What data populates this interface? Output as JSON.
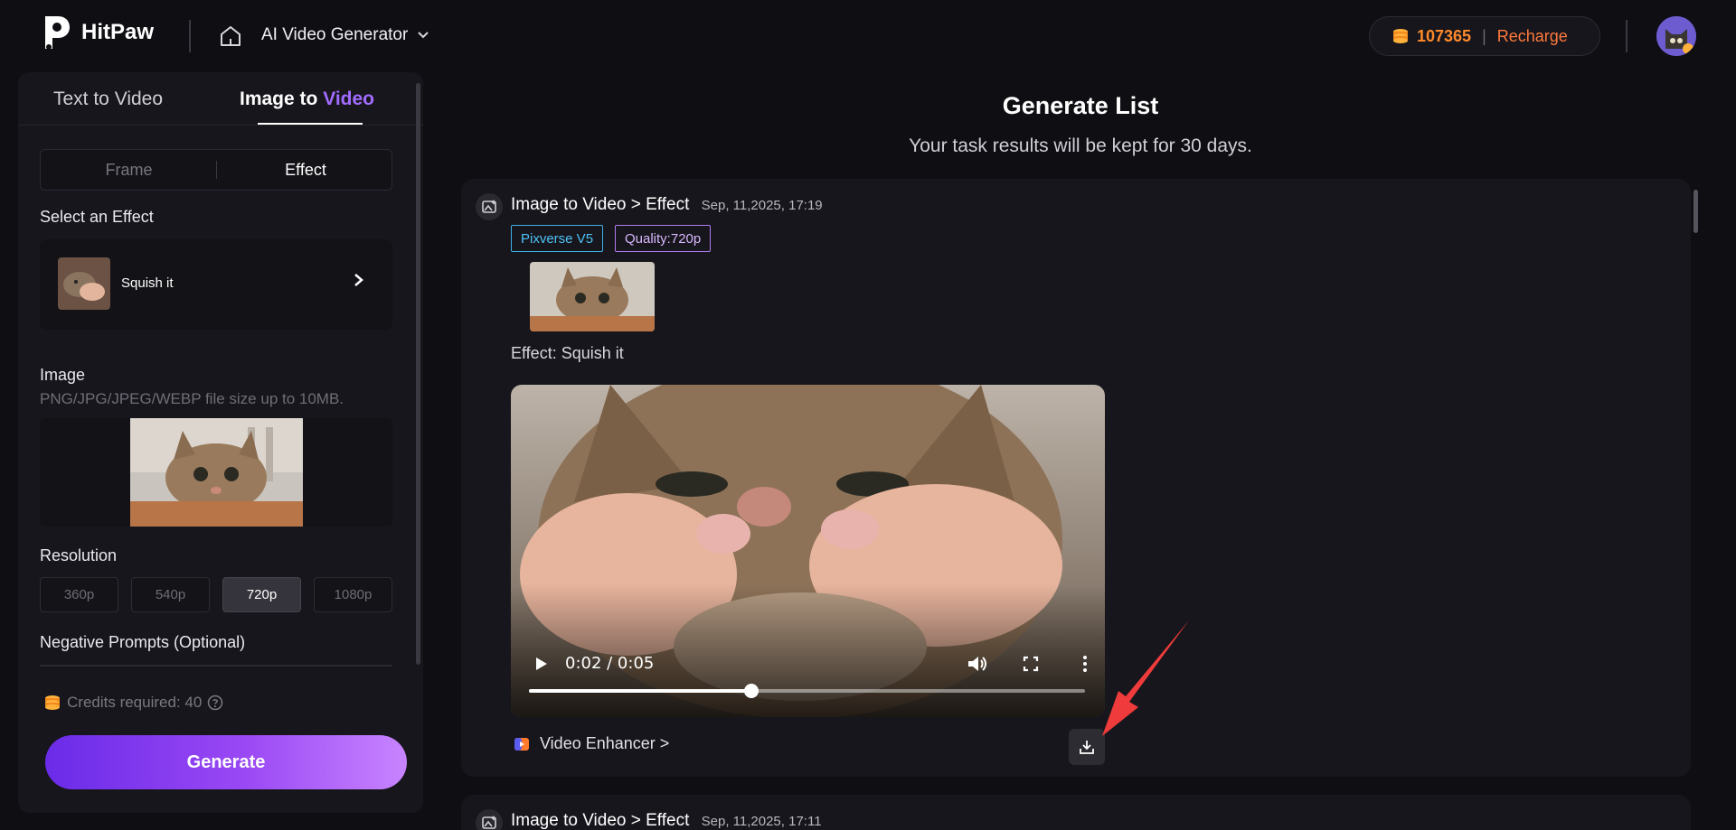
{
  "header": {
    "brand": "HitPaw",
    "nav_title": "AI Video Generator",
    "credits": "107365",
    "recharge_label": "Recharge",
    "colors": {
      "credits": "#ff8a2b",
      "recharge": "#ff7a3d"
    }
  },
  "left": {
    "tabs": [
      {
        "label": "Text to Video"
      },
      {
        "label_white": "Image to",
        "label_accent": "Video"
      }
    ],
    "segments": {
      "frame": "Frame",
      "effect": "Effect"
    },
    "select_effect_label": "Select an Effect",
    "effect_name": "Squish it",
    "image_label": "Image",
    "image_hint": "PNG/JPG/JPEG/WEBP file size up to 10MB.",
    "resolution_label": "Resolution",
    "resolutions": [
      "360p",
      "540p",
      "720p",
      "1080p"
    ],
    "resolution_selected": "720p",
    "negative_label": "Negative Prompts (Optional)",
    "credits_required": "Credits required: 40",
    "generate_label": "Generate",
    "accent_color": "#a26cff"
  },
  "main": {
    "title": "Generate List",
    "subtitle": "Your task results will be kept for 30 days.",
    "tasks": [
      {
        "title": "Image to Video > Effect",
        "date": "Sep, 11,2025, 17:19",
        "model_tag": "Pixverse V5",
        "quality_tag": "Quality:720p",
        "effect_line": "Effect: Squish it",
        "video_time": "0:02 / 0:05",
        "video_progress": 0.4,
        "enhancer_label": "Video Enhancer >"
      },
      {
        "title": "Image to Video > Effect",
        "date": "Sep, 11,2025, 17:11"
      }
    ]
  }
}
